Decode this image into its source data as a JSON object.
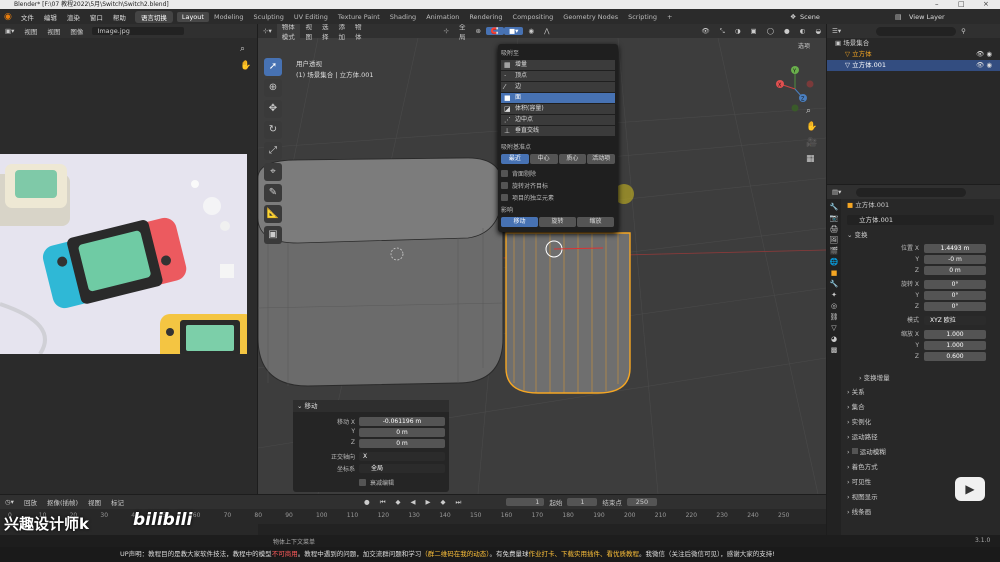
{
  "titlebar": {
    "title": "Blender* [F:\\07 教程2022\\5月\\Switch\\Switch2.blend]",
    "controls": [
      "–",
      "□",
      "×"
    ]
  },
  "topbar": {
    "menus": [
      "文件",
      "编辑",
      "渲染",
      "窗口",
      "帮助"
    ],
    "lang_toggle": "语言切换",
    "workspaces": [
      "Layout",
      "Modeling",
      "Sculpting",
      "UV Editing",
      "Texture Paint",
      "Shading",
      "Animation",
      "Rendering",
      "Compositing",
      "Geometry Nodes",
      "Scripting"
    ],
    "active_workspace": "Layout",
    "add_tab": "+",
    "scene_label": "Scene",
    "viewlayer_label": "View Layer"
  },
  "image_editor": {
    "menus": [
      "视图",
      "视图",
      "图像"
    ],
    "image_name": "Image.jpg"
  },
  "viewport": {
    "mode": "物体模式",
    "menus": [
      "视图",
      "选择",
      "添加",
      "物体"
    ],
    "transform_orientation": "全局",
    "options_label": "选项",
    "overlay_title": "用户透视",
    "overlay_subtitle": "(1) 场景集合 | 立方体.001",
    "axis_labels": {
      "x": "X",
      "y": "Y",
      "z": "Z"
    }
  },
  "snap_popup": {
    "title": "吸附至",
    "items": [
      {
        "icon": "▦",
        "label": "增量"
      },
      {
        "icon": "·",
        "label": "顶点"
      },
      {
        "icon": "⁄",
        "label": "边"
      },
      {
        "icon": "■",
        "label": "面"
      },
      {
        "icon": "◪",
        "label": "体积(容量)"
      },
      {
        "icon": "⋰",
        "label": "边中点"
      },
      {
        "icon": "⊥",
        "label": "垂直交线"
      }
    ],
    "selected_item": "面",
    "base_title": "吸附基准点",
    "base_options": [
      "最近",
      "中心",
      "质心",
      "活动项"
    ],
    "base_active": "最近",
    "checks": [
      "背面剔除",
      "旋转对齐目标",
      "项目的独立元素"
    ],
    "affect_title": "影响",
    "affect_options": [
      "移动",
      "旋转",
      "缩放"
    ],
    "affect_active": "移动"
  },
  "last_op": {
    "title": "移动",
    "fields": [
      {
        "label": "移动 X",
        "value": "-0.061196 m"
      },
      {
        "label": "Y",
        "value": "0 m"
      },
      {
        "label": "Z",
        "value": "0 m"
      }
    ],
    "orient_label": "正交轴向",
    "orient_value": "X",
    "coord_label": "坐标系",
    "coord_value": "全局",
    "falloff_label": "衰减编辑"
  },
  "timeline": {
    "menus": [
      "回放",
      "抠像(插帧)",
      "视图",
      "标记"
    ],
    "current_frame": "1",
    "start_label": "起始",
    "start": "1",
    "end_label": "结束点",
    "end": "250",
    "ticks": [
      "0",
      "10",
      "20",
      "30",
      "40",
      "50",
      "60",
      "70",
      "80",
      "90",
      "100",
      "110",
      "120",
      "130",
      "140",
      "150",
      "160",
      "170",
      "180",
      "190",
      "200",
      "210",
      "220",
      "230",
      "240",
      "250"
    ],
    "status_hint": "物体上下文菜单"
  },
  "watermark": {
    "author": "兴趣设计师k",
    "logo": "bilibili"
  },
  "outliner": {
    "root": "场景集合",
    "items": [
      {
        "label": "立方体"
      },
      {
        "label": "立方体.001"
      }
    ]
  },
  "properties": {
    "object_name": "立方体.001",
    "object_field": "立方体.001",
    "transform_title": "变换",
    "location": {
      "label": "位置 X",
      "x": "1.4493 m",
      "y": "-0 m",
      "z": "0 m"
    },
    "rotation": {
      "label": "旋转 X",
      "x": "0°",
      "y": "0°",
      "z": "0°"
    },
    "mode_label": "模式",
    "mode_value": "XYZ 欧拉",
    "scale": {
      "label": "缩放 X",
      "x": "1.000",
      "y": "1.000",
      "z": "0.600"
    },
    "axis_y": "Y",
    "axis_z": "Z",
    "delta_title": "变换增量",
    "sections": [
      "关系",
      "集合",
      "实例化",
      "运动路径",
      "运动模糊",
      "着色方式",
      "可见性",
      "视图显示",
      "线条画"
    ]
  },
  "footer_notice": {
    "prefix": "UP声明：教程目的是教大家软件技法，教程中的模型",
    "red1": "不可商用",
    "mid1": "。教程中遇到的问题，加交流群问题和学习",
    "orange1": "（群二维码在我的动态）",
    "mid2": "。有免费量球",
    "orange2": "作业打卡、下载实用插件、看优质教程",
    "suffix": "。我微信（关注后微信可见），感谢大家的支持!",
    "version": "3.1.0"
  },
  "colors": {
    "accent": "#4772b3",
    "selected_object": "#f5a623",
    "ui_bg": "#1d1d1d",
    "viewport_bg": "#3d3d3d"
  }
}
